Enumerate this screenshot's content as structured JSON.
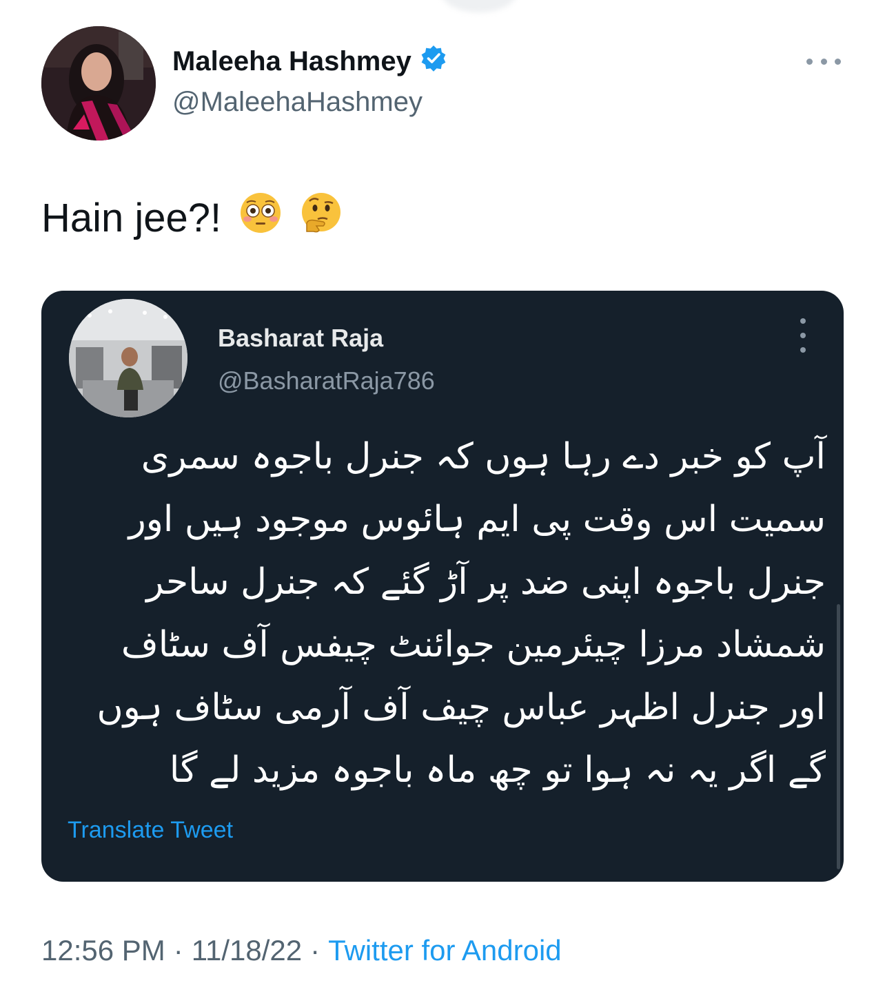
{
  "author": {
    "display_name": "Maleeha Hashmey",
    "handle": "@MaleehaHashmey",
    "verified": true,
    "verified_color": "#1d9bf0"
  },
  "tweet": {
    "text": "Hain jee?!",
    "emojis": [
      "😳",
      "🤔"
    ]
  },
  "quoted_tweet": {
    "display_name": "Basharat Raja",
    "handle": "@BasharatRaja786",
    "lines": [
      "آپ کو خبر دے رہا ہوں کہ جنرل باجوہ سمری",
      "سمیت اس وقت پی ایم ہائوس موجود ہیں اور",
      "جنرل باجوہ اپنی ضد پر آڑ گئے کہ جنرل ساحر",
      "شمشاد مرزا چیئرمین جوائنٹ چیفس آف سٹاف",
      "اور جنرل اظہر عباس چیف آف آرمی سٹاف ہوں",
      "گے اگر یہ نہ ہوا تو چھ ماہ باجوہ مزید لے گا"
    ],
    "translate_label": "Translate Tweet",
    "background_color": "#15202b"
  },
  "meta": {
    "time": "12:56 PM",
    "separator": "·",
    "date": "11/18/22",
    "source": "Twitter for Android"
  }
}
